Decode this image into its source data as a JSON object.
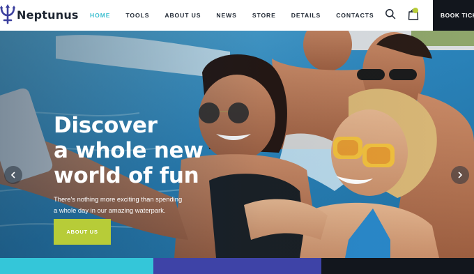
{
  "brand": {
    "name": "Neptunus",
    "logo_icon": "trident-icon"
  },
  "nav": {
    "items": [
      {
        "label": "HOME",
        "active": true
      },
      {
        "label": "TOOLS",
        "active": false
      },
      {
        "label": "ABOUT US",
        "active": false
      },
      {
        "label": "NEWS",
        "active": false
      },
      {
        "label": "STORE",
        "active": false
      },
      {
        "label": "DETAILS",
        "active": false
      },
      {
        "label": "CONTACTS",
        "active": false
      }
    ]
  },
  "header_actions": {
    "search_icon": "search-icon",
    "cart_icon": "shopping-bag-icon",
    "book_label": "BOOK TICKETS"
  },
  "hero": {
    "title_lines": [
      "Discover",
      "a whole new",
      "world of fun"
    ],
    "description_lines": [
      "There's nothing more exciting than spending",
      "a whole day in our amazing waterpark."
    ],
    "button_label": "ABOUT US",
    "prev_icon": "chevron-left-icon",
    "next_icon": "chevron-right-icon"
  },
  "colors": {
    "accent_cyan": "#34c6d9",
    "accent_lime": "#b7cc38",
    "accent_indigo": "#3e43a7",
    "dark": "#12161d",
    "logo_purple": "#3b3f9e"
  }
}
